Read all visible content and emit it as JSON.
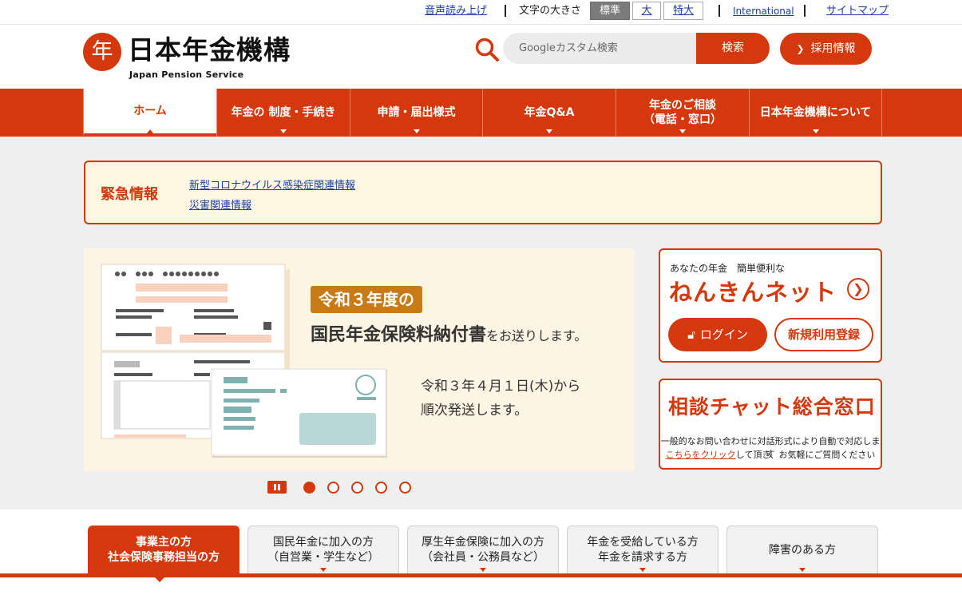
{
  "util_bar": {
    "voice_reading": "音声読み上げ",
    "font_size_label": "文字の大きさ",
    "font_sizes": [
      "標準",
      "大",
      "特大"
    ],
    "international": "International",
    "sitemap": "サイトマップ"
  },
  "header": {
    "logo_mark": "年",
    "logo_text": "日本年金機構",
    "logo_sub": "Japan Pension Service",
    "search_placeholder": "Googleカスタム検索",
    "search_button": "検索",
    "recruit_button": "採用情報"
  },
  "nav": {
    "tabs": [
      {
        "label": "ホーム"
      },
      {
        "label": "年金の 制度・手続き"
      },
      {
        "label": "申請・届出様式"
      },
      {
        "label": "年金Q&A"
      },
      {
        "label_line1": "年金のご相談",
        "label_line2": "（電話・窓口）"
      },
      {
        "label": "日本年金機構について"
      }
    ]
  },
  "emergency": {
    "label": "緊急情報",
    "links": [
      "新型コロナウイルス感染症関連情報",
      "災害関連情報"
    ]
  },
  "slide": {
    "badge": "令和３年度の",
    "title": "国民年金保険料納付書",
    "title_suffix": "をお送りします。",
    "note_line1": "令和３年４月１日(木)から",
    "note_line2": "順次発送します。"
  },
  "nenkin_net": {
    "pre": "あなたの年金　簡単便利な",
    "title": "ねんきんネット",
    "login": "ログイン",
    "register": "新規利用登録"
  },
  "chat": {
    "title": "相談チャット総合窓口",
    "desc1": "一般的なお問い合わせに対話形式により自動で対応します",
    "desc2_link": "こちらをクリック",
    "desc2_rest": "して頂き、お気軽にご質問ください"
  },
  "audience_tabs": [
    {
      "line1": "事業主の方",
      "line2": "社会保険事務担当の方"
    },
    {
      "line1": "国民年金に加入の方",
      "line2": "（自営業・学生など）"
    },
    {
      "line1": "厚生年金保険に加入の方",
      "line2": "（会社員・公務員など）"
    },
    {
      "line1": "年金を受給している方",
      "line2": "年金を請求する方"
    },
    {
      "line1": "障害のある方",
      "line2": ""
    }
  ],
  "colors": {
    "brand": "#d6380d",
    "link": "#1a3fa0",
    "notice_bg": "#fdf6e1"
  }
}
